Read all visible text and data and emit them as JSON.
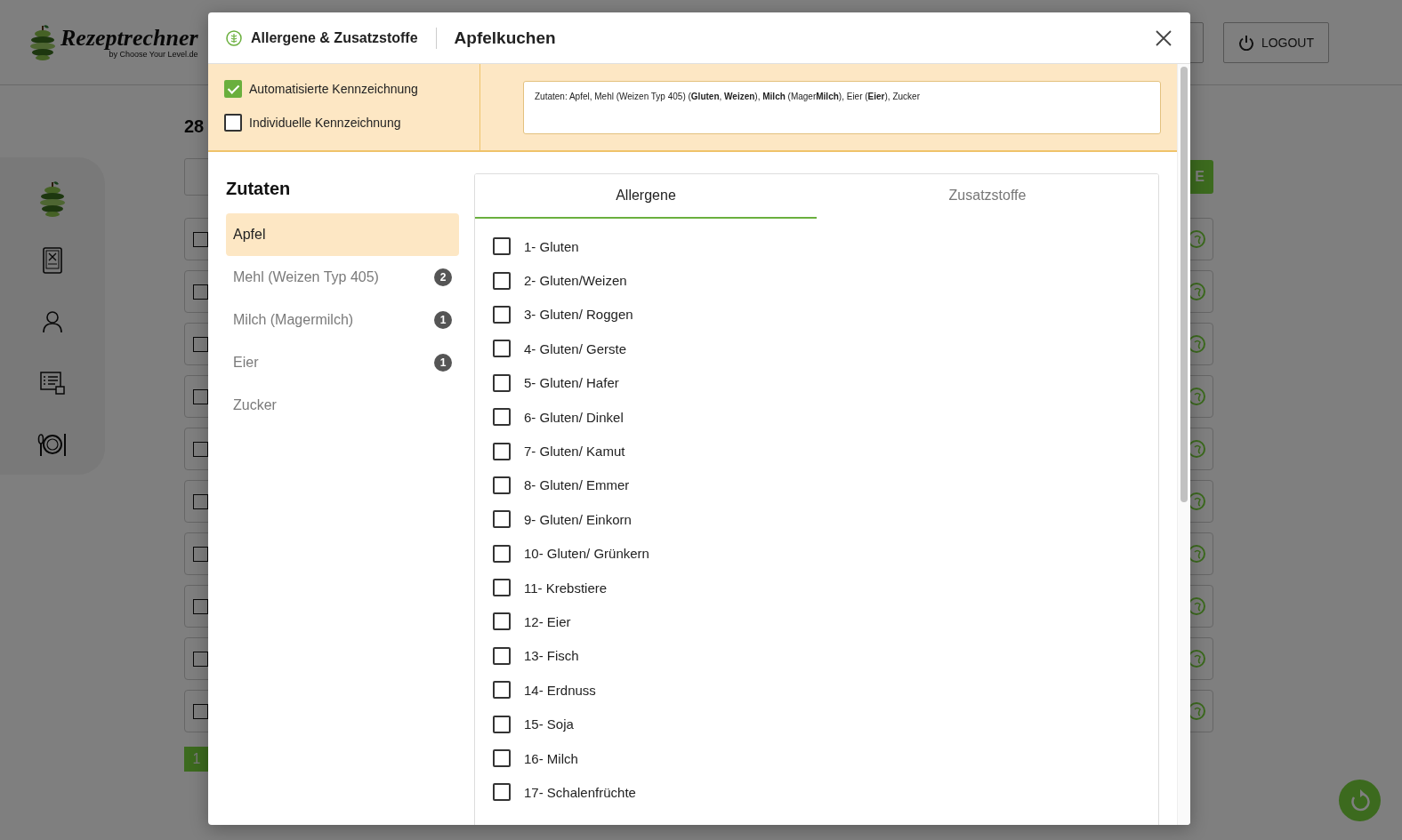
{
  "header": {
    "logo_title": "Rezeptrechner",
    "logo_subtitle": "by Choose Your Level.de",
    "logout_label": "LOGOUT"
  },
  "sidebar": {
    "items": [
      {
        "kind": "logo"
      },
      {
        "kind": "recipes"
      },
      {
        "kind": "user"
      },
      {
        "kind": "checklist"
      },
      {
        "kind": "dining"
      }
    ]
  },
  "page": {
    "count": "28",
    "action_button": "E",
    "rows": [
      {
        "checked": false
      },
      {
        "checked": false
      },
      {
        "checked": false
      },
      {
        "checked": false
      },
      {
        "checked": false
      },
      {
        "checked": false
      },
      {
        "checked": false
      },
      {
        "checked": false
      },
      {
        "checked": false
      },
      {
        "checked": false
      }
    ],
    "pagination": [
      {
        "label": "1",
        "selected": true
      }
    ]
  },
  "modal": {
    "title": "Allergene & Zusatzstoffe",
    "subtitle": "Apfelkuchen",
    "options": [
      {
        "label": "Automatisierte Kennzeichnung",
        "checked": true
      },
      {
        "label": "Individuelle Kennzeichnung",
        "checked": false
      }
    ],
    "declaration": "Zutaten: Apfel, Mehl (Weizen Typ 405) (**Gluten**, **Weizen**), **Milch** (Mager**Milch**), Eier (**Eier**), Zucker",
    "ingredients_title": "Zutaten",
    "ingredients": [
      {
        "name": "Apfel",
        "selected": true
      },
      {
        "name": "Mehl (Weizen Typ 405)",
        "count": "2",
        "selected": false
      },
      {
        "name": "Milch (Magermilch)",
        "count": "1",
        "selected": false
      },
      {
        "name": "Eier",
        "count": "1",
        "selected": false
      },
      {
        "name": "Zucker",
        "selected": false
      }
    ],
    "tabs": [
      {
        "label": "Allergene",
        "selected": true
      },
      {
        "label": "Zusatzstoffe",
        "selected": false
      }
    ],
    "allergens": [
      {
        "label": "1- Gluten",
        "checked": false
      },
      {
        "label": "2- Gluten/Weizen",
        "checked": false
      },
      {
        "label": "3- Gluten/ Roggen",
        "checked": false
      },
      {
        "label": "4- Gluten/ Gerste",
        "checked": false
      },
      {
        "label": "5- Gluten/ Hafer",
        "checked": false
      },
      {
        "label": "6- Gluten/ Dinkel",
        "checked": false
      },
      {
        "label": "7- Gluten/ Kamut",
        "checked": false
      },
      {
        "label": "8- Gluten/ Emmer",
        "checked": false
      },
      {
        "label": "9- Gluten/ Einkorn",
        "checked": false
      },
      {
        "label": "10- Gluten/ Grünkern",
        "checked": false
      },
      {
        "label": "11- Krebstiere",
        "checked": false
      },
      {
        "label": "12- Eier",
        "checked": false
      },
      {
        "label": "13- Fisch",
        "checked": false
      },
      {
        "label": "14- Erdnuss",
        "checked": false
      },
      {
        "label": "15- Soja",
        "checked": false
      },
      {
        "label": "16- Milch",
        "checked": false
      },
      {
        "label": "17- Schalenfrüchte",
        "checked": false
      }
    ]
  }
}
